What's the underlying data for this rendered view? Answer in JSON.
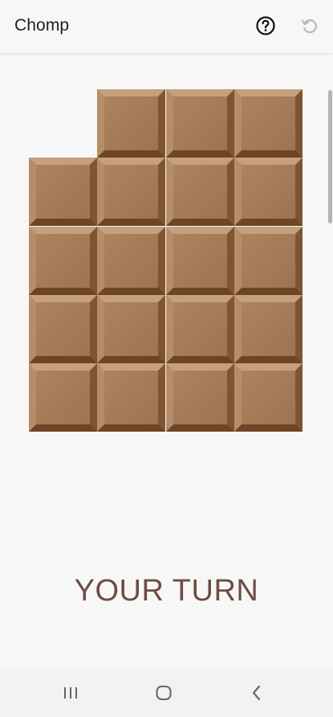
{
  "app_bar": {
    "title": "Chomp",
    "help_icon": "help-circle-icon",
    "reset_icon": "refresh-icon"
  },
  "board": {
    "rows": 5,
    "cols": 4,
    "squares": [
      [
        false,
        true,
        true,
        true
      ],
      [
        true,
        true,
        true,
        true
      ],
      [
        true,
        true,
        true,
        true
      ],
      [
        true,
        true,
        true,
        true
      ],
      [
        true,
        true,
        true,
        true
      ]
    ],
    "colors": {
      "face": "#a77b57",
      "highlight": "#c6a07c",
      "shadow": "#6c4526"
    }
  },
  "status": {
    "text": "YOUR TURN",
    "color": "#6e4c42"
  },
  "nav_bar": {
    "recents_icon": "recents-icon",
    "home_icon": "home-icon",
    "back_icon": "back-icon"
  }
}
